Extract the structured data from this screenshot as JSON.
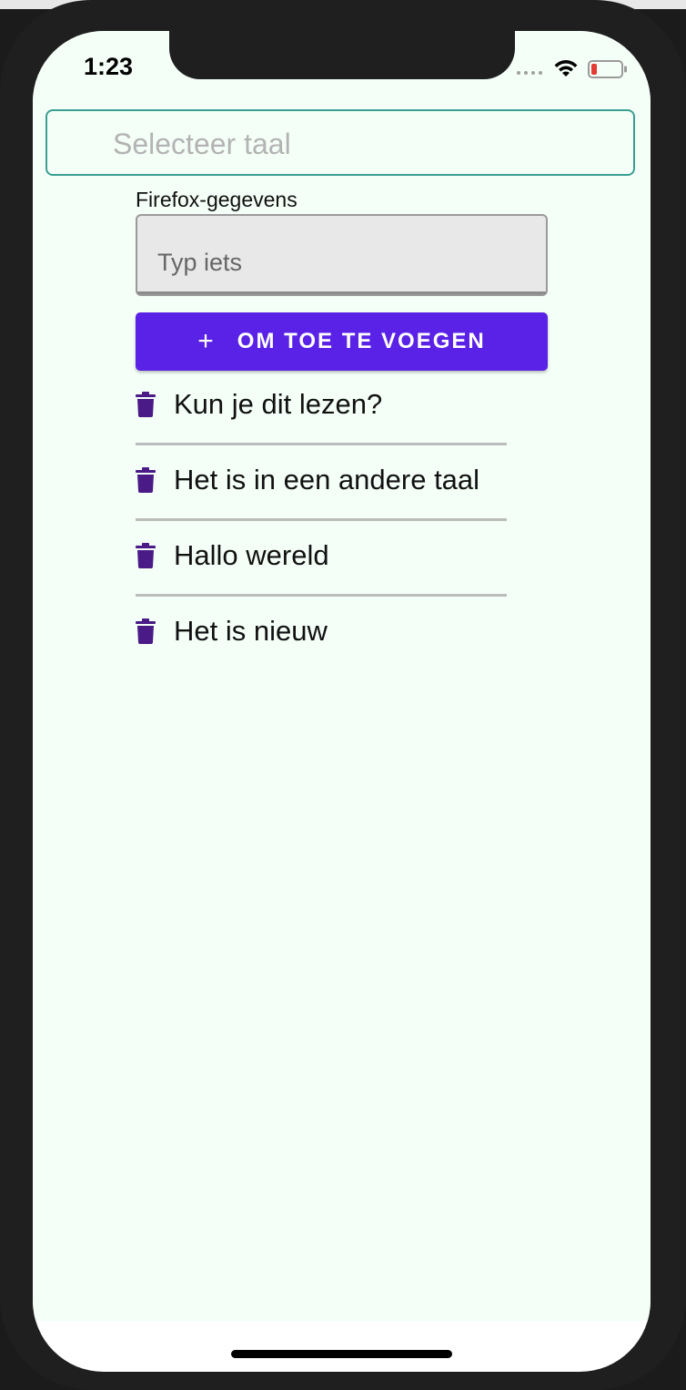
{
  "status_bar": {
    "time": "1:23",
    "wifi_icon": "wifi-icon",
    "battery_icon": "battery-low-icon",
    "battery_color": "#e53935"
  },
  "language_select": {
    "placeholder": "Selecteer taal",
    "border_color": "#3a9e92"
  },
  "input": {
    "label": "Firefox-gegevens",
    "placeholder": "Typ iets",
    "value": ""
  },
  "add_button": {
    "icon": "plus-icon",
    "label": "OM TOE TE VOEGEN",
    "color": "#5a22e6"
  },
  "todos": [
    {
      "text": "Kun je dit lezen?",
      "icon": "trash-icon"
    },
    {
      "text": "Het is in een andere taal",
      "icon": "trash-icon"
    },
    {
      "text": "Hallo wereld",
      "icon": "trash-icon"
    },
    {
      "text": "Het is nieuw",
      "icon": "trash-icon"
    }
  ],
  "colors": {
    "app_background": "#f4fff8",
    "trash_icon": "#4a1a86"
  }
}
